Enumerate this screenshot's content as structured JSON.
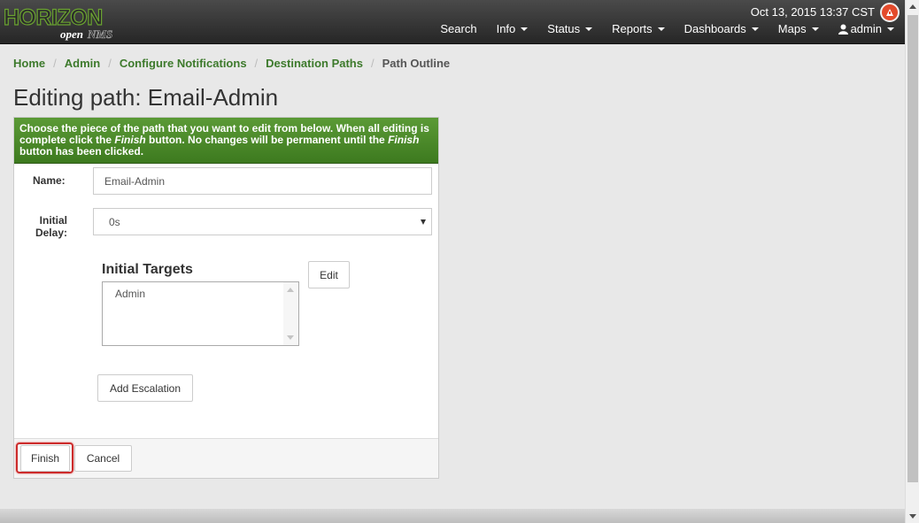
{
  "header": {
    "logo_horizon": "HORIZON",
    "logo_open": "open",
    "logo_nms": "NMS",
    "datetime": "Oct 13, 2015 13:37 CST",
    "nav": [
      {
        "label": "Search",
        "dropdown": false
      },
      {
        "label": "Info",
        "dropdown": true
      },
      {
        "label": "Status",
        "dropdown": true
      },
      {
        "label": "Reports",
        "dropdown": true
      },
      {
        "label": "Dashboards",
        "dropdown": true
      },
      {
        "label": "Maps",
        "dropdown": true
      },
      {
        "label": "admin",
        "dropdown": true,
        "icon": "user-icon"
      }
    ]
  },
  "breadcrumb": [
    "Home",
    "Admin",
    "Configure Notifications",
    "Destination Paths"
  ],
  "breadcrumb_active": "Path Outline",
  "page_title": "Editing path: Email-Admin",
  "panel": {
    "instructions_1": "Choose the piece of the path that you want to edit from below. When all editing is complete click the ",
    "instructions_finish1": "Finish",
    "instructions_2": " button. No changes will be permanent until the ",
    "instructions_finish2": "Finish",
    "instructions_3": " button has been clicked.",
    "name_label": "Name:",
    "name_value": "Email-Admin",
    "delay_label_1": "Initial",
    "delay_label_2": "Delay:",
    "delay_value": "0s",
    "targets_title": "Initial Targets",
    "targets": [
      "Admin"
    ],
    "edit_button": "Edit",
    "add_escalation_button": "Add Escalation",
    "finish_button": "Finish",
    "cancel_button": "Cancel"
  },
  "colors": {
    "navbar": "#333333",
    "panel_heading": "#4a8a28",
    "link_green": "#3d7a2c",
    "highlight": "#cc2b2b"
  }
}
